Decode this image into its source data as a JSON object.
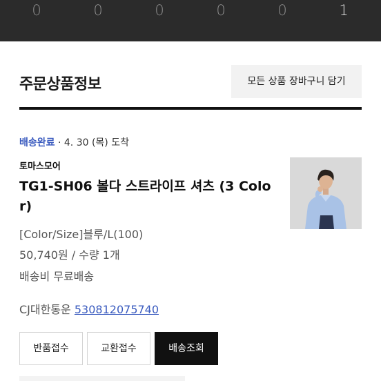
{
  "status_counts": [
    "0",
    "0",
    "0",
    "0",
    "0",
    "1"
  ],
  "order_section": {
    "title": "주문상품정보",
    "cart_all_label": "모든 상품 장바구니 담기"
  },
  "delivery": {
    "status": "배송완료",
    "separator": " · ",
    "date_text": "4. 30 (목) 도착"
  },
  "product": {
    "brand": "토마스모어",
    "name": "TG1-SH06 볼다 스트라이프 셔츠 (3 Color)",
    "option": "[Color/Size]블루/L(100)",
    "price_qty": "50,740원 / 수량 1개",
    "shipping": "배송비 무료배송"
  },
  "tracking": {
    "courier": "CJ대한통운",
    "number": "530812075740"
  },
  "actions": {
    "return_label": "반품접수",
    "exchange_label": "교환접수",
    "track_label": "배송조회"
  },
  "colors": {
    "accent_blue": "#3a5bbf",
    "dark_strip": "#2b2b2b",
    "primary_button": "#111111"
  }
}
